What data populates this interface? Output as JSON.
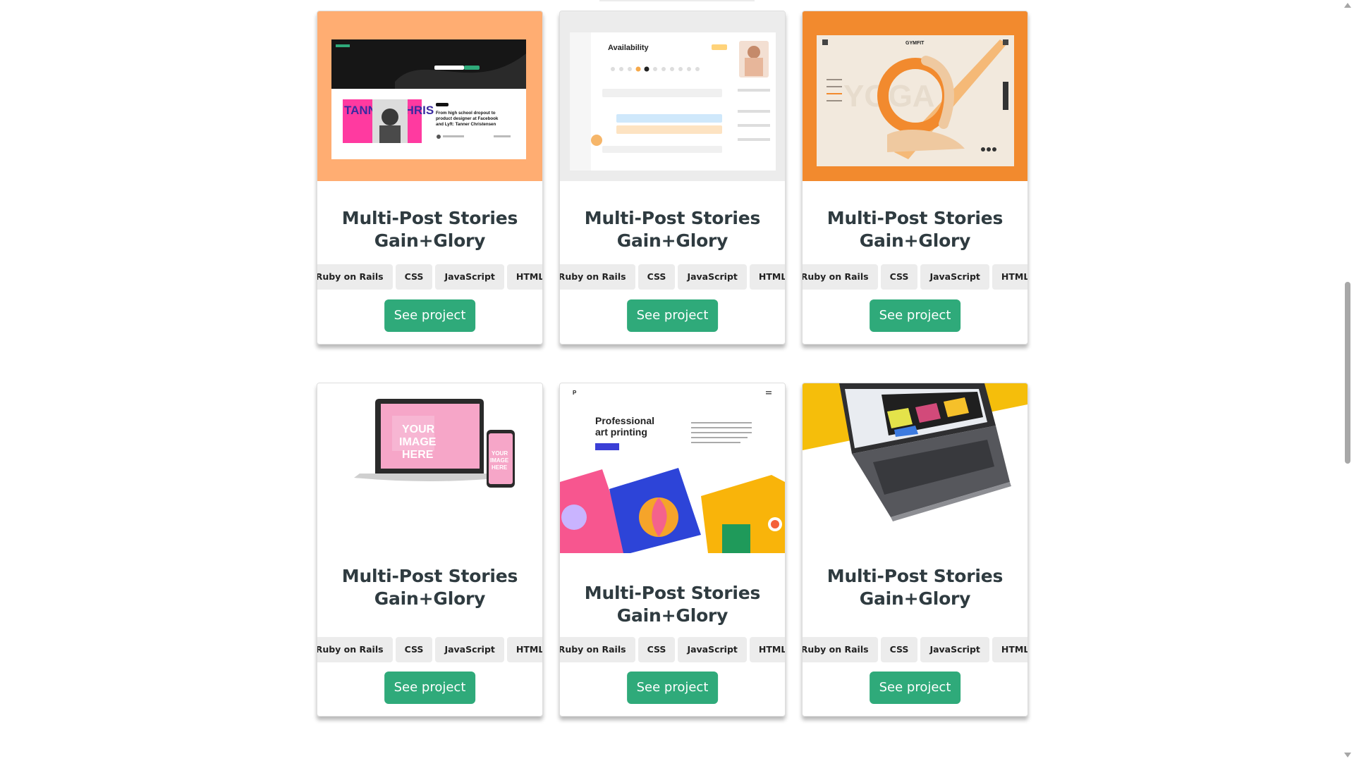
{
  "cards": [
    {
      "title": "Multi-Post Stories Gain+Glory",
      "tags": [
        "Ruby on Rails",
        "CSS",
        "JavaScript",
        "HTML"
      ],
      "button": "See project"
    },
    {
      "title": "Multi-Post Stories Gain+Glory",
      "tags": [
        "Ruby on Rails",
        "CSS",
        "JavaScript",
        "HTML"
      ],
      "button": "See project"
    },
    {
      "title": "Multi-Post Stories Gain+Glory",
      "tags": [
        "Ruby on Rails",
        "CSS",
        "JavaScript",
        "HTML"
      ],
      "button": "See project"
    },
    {
      "title": "Multi-Post Stories Gain+Glory",
      "tags": [
        "Ruby on Rails",
        "CSS",
        "JavaScript",
        "HTML"
      ],
      "button": "See project"
    },
    {
      "title": "Multi-Post Stories Gain+Glory",
      "tags": [
        "Ruby on Rails",
        "CSS",
        "JavaScript",
        "HTML"
      ],
      "button": "See project"
    },
    {
      "title": "Multi-Post Stories Gain+Glory",
      "tags": [
        "Ruby on Rails",
        "CSS",
        "JavaScript",
        "HTML"
      ],
      "button": "See project"
    }
  ],
  "previews": {
    "blog": {
      "post_title": "From high school dropout to product designer at Facebook and Lyft: Tanner Christensen",
      "banner": "TANNER CHRIS"
    },
    "dashboard": {
      "heading": "Availability"
    },
    "gym": {
      "brand": "GYMFIT",
      "bg_word": "YOGA"
    },
    "mockup": {
      "screen_text": "YOUR IMAGE HERE"
    },
    "printing": {
      "heading": "Professional art printing",
      "logo": "P"
    }
  },
  "colors": {
    "accent": "#2faa7a",
    "tag_bg": "#ececec",
    "title": "#2f3b40"
  }
}
